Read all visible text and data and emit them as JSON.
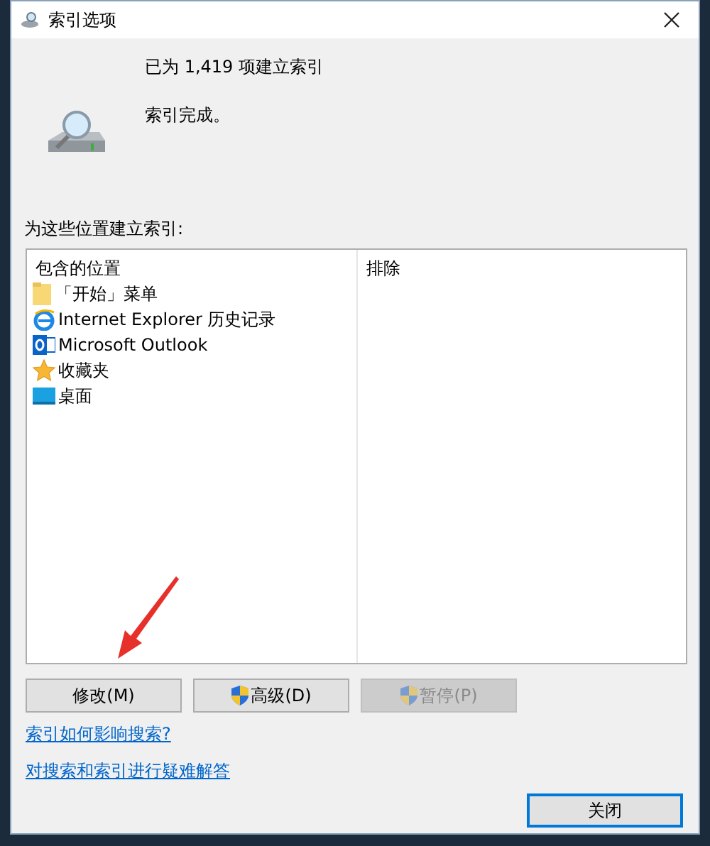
{
  "window": {
    "title": "索引选项"
  },
  "status": {
    "count_line": "已为 1,419 项建立索引",
    "state_line": "索引完成。"
  },
  "locations_label": "为这些位置建立索引:",
  "table": {
    "columns": [
      "包含的位置",
      "排除"
    ],
    "rows": [
      {
        "kind": "folder",
        "name": "「开始」菜单"
      },
      {
        "kind": "browser",
        "name": "Internet Explorer 历史记录"
      },
      {
        "kind": "mail",
        "name": "Microsoft Outlook"
      },
      {
        "kind": "star",
        "name": "收藏夹"
      },
      {
        "kind": "desktop",
        "name": "桌面"
      }
    ]
  },
  "buttons": [
    {
      "label": "修改(M)",
      "shield": false,
      "disabled": false
    },
    {
      "label": "高级(D)",
      "shield": true,
      "disabled": false
    },
    {
      "label": "暂停(P)",
      "shield": true,
      "disabled": true
    }
  ],
  "links": [
    "索引如何影响搜索?",
    "对搜索和索引进行疑难解答"
  ],
  "close_button": {
    "label": "关闭",
    "default": true
  }
}
